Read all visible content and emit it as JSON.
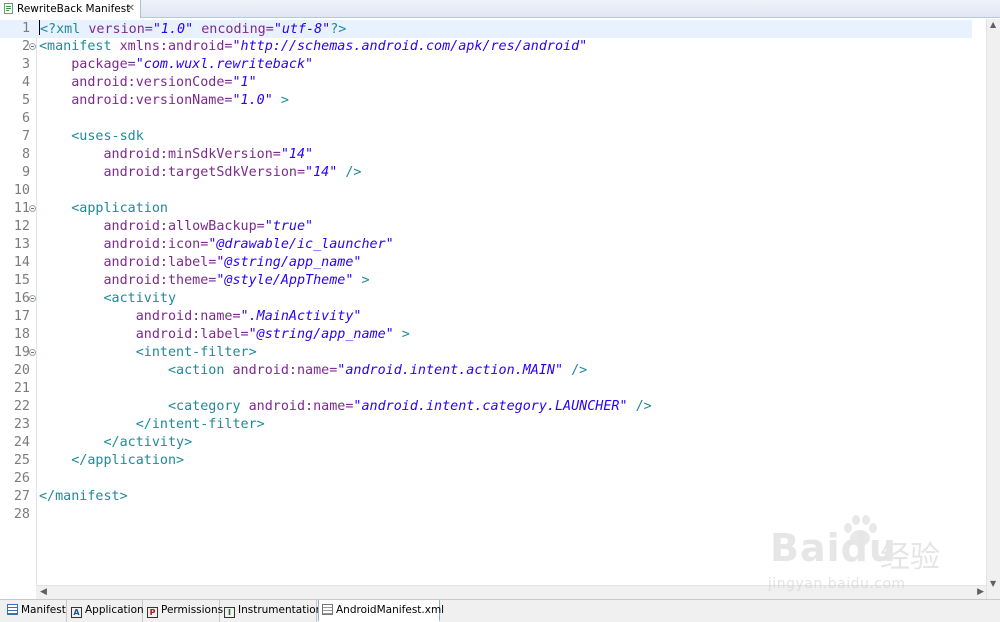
{
  "editor_tab": {
    "title": "RewriteBack Manifest",
    "close_glyph": "✕"
  },
  "lines": [
    {
      "n": "1",
      "parts": [
        {
          "t": "<?",
          "c": "tg"
        },
        {
          "t": "xml ",
          "c": "tg"
        },
        {
          "t": "version=",
          "c": "at"
        },
        {
          "t": "\"1.0\"",
          "c": "vl"
        },
        {
          "t": " encoding=",
          "c": "at"
        },
        {
          "t": "\"utf-8\"",
          "c": "vl"
        },
        {
          "t": "?>",
          "c": "tg"
        }
      ]
    },
    {
      "n": "2",
      "fold": true,
      "parts": [
        {
          "t": "<manifest ",
          "c": "tg"
        },
        {
          "t": "xmlns:android=",
          "c": "at"
        },
        {
          "t": "\"http://schemas.android.com/apk/res/android\"",
          "c": "vl"
        }
      ]
    },
    {
      "n": "3",
      "parts": [
        {
          "t": "    package=",
          "c": "at"
        },
        {
          "t": "\"com.wuxl.rewriteback\"",
          "c": "vl"
        }
      ]
    },
    {
      "n": "4",
      "parts": [
        {
          "t": "    android:versionCode=",
          "c": "at"
        },
        {
          "t": "\"1\"",
          "c": "vl"
        }
      ]
    },
    {
      "n": "5",
      "parts": [
        {
          "t": "    android:versionName=",
          "c": "at"
        },
        {
          "t": "\"1.0\"",
          "c": "vl"
        },
        {
          "t": " >",
          "c": "tg"
        }
      ]
    },
    {
      "n": "6",
      "parts": []
    },
    {
      "n": "7",
      "parts": [
        {
          "t": "    <uses-sdk",
          "c": "tg"
        }
      ]
    },
    {
      "n": "8",
      "parts": [
        {
          "t": "        android:minSdkVersion=",
          "c": "at"
        },
        {
          "t": "\"14\"",
          "c": "vl"
        }
      ]
    },
    {
      "n": "9",
      "parts": [
        {
          "t": "        android:targetSdkVersion=",
          "c": "at"
        },
        {
          "t": "\"14\"",
          "c": "vl"
        },
        {
          "t": " />",
          "c": "tg"
        }
      ]
    },
    {
      "n": "10",
      "parts": []
    },
    {
      "n": "11",
      "fold": true,
      "parts": [
        {
          "t": "    <application",
          "c": "tg"
        }
      ]
    },
    {
      "n": "12",
      "parts": [
        {
          "t": "        android:allowBackup=",
          "c": "at"
        },
        {
          "t": "\"true\"",
          "c": "vl"
        }
      ]
    },
    {
      "n": "13",
      "parts": [
        {
          "t": "        android:icon=",
          "c": "at"
        },
        {
          "t": "\"@drawable/ic_launcher\"",
          "c": "vl"
        }
      ]
    },
    {
      "n": "14",
      "parts": [
        {
          "t": "        android:label=",
          "c": "at"
        },
        {
          "t": "\"@string/app_name\"",
          "c": "vl"
        }
      ]
    },
    {
      "n": "15",
      "parts": [
        {
          "t": "        android:theme=",
          "c": "at"
        },
        {
          "t": "\"@style/AppTheme\"",
          "c": "vl"
        },
        {
          "t": " >",
          "c": "tg"
        }
      ]
    },
    {
      "n": "16",
      "fold": true,
      "parts": [
        {
          "t": "        <activity",
          "c": "tg"
        }
      ]
    },
    {
      "n": "17",
      "parts": [
        {
          "t": "            android:name=",
          "c": "at"
        },
        {
          "t": "\".MainActivity\"",
          "c": "vl"
        }
      ]
    },
    {
      "n": "18",
      "parts": [
        {
          "t": "            android:label=",
          "c": "at"
        },
        {
          "t": "\"@string/app_name\"",
          "c": "vl"
        },
        {
          "t": " >",
          "c": "tg"
        }
      ]
    },
    {
      "n": "19",
      "fold": true,
      "parts": [
        {
          "t": "            <intent-filter>",
          "c": "tg"
        }
      ]
    },
    {
      "n": "20",
      "parts": [
        {
          "t": "                <action ",
          "c": "tg"
        },
        {
          "t": "android:name=",
          "c": "at"
        },
        {
          "t": "\"android.intent.action.MAIN\"",
          "c": "vl"
        },
        {
          "t": " />",
          "c": "tg"
        }
      ]
    },
    {
      "n": "21",
      "parts": []
    },
    {
      "n": "22",
      "parts": [
        {
          "t": "                <category ",
          "c": "tg"
        },
        {
          "t": "android:name=",
          "c": "at"
        },
        {
          "t": "\"android.intent.category.LAUNCHER\"",
          "c": "vl"
        },
        {
          "t": " />",
          "c": "tg"
        }
      ]
    },
    {
      "n": "23",
      "parts": [
        {
          "t": "            </intent-filter>",
          "c": "tg"
        }
      ]
    },
    {
      "n": "24",
      "parts": [
        {
          "t": "        </activity>",
          "c": "tg"
        }
      ]
    },
    {
      "n": "25",
      "parts": [
        {
          "t": "    </application>",
          "c": "tg"
        }
      ]
    },
    {
      "n": "26",
      "parts": []
    },
    {
      "n": "27",
      "parts": [
        {
          "t": "</manifest>",
          "c": "tg"
        }
      ]
    },
    {
      "n": "28",
      "parts": []
    }
  ],
  "bottom_tabs": [
    {
      "label": "Manifest",
      "icon_glyph": "",
      "icon": "manifest-icon",
      "active": false
    },
    {
      "label": "Application",
      "icon_glyph": "A",
      "icon": "application-icon",
      "active": false
    },
    {
      "label": "Permissions",
      "icon_glyph": "P",
      "icon": "permissions-icon",
      "active": false
    },
    {
      "label": "Instrumentation",
      "icon_glyph": "I",
      "icon": "instrumentation-icon",
      "active": false
    },
    {
      "label": "AndroidManifest.xml",
      "icon_glyph": "",
      "icon": "xml-file-icon",
      "active": true
    }
  ],
  "watermark": {
    "brand": "Bai",
    "brand2": "du",
    "cn": "经验",
    "url": "jingyan.baidu.com"
  },
  "colors": {
    "tag": "#1f8a98",
    "attribute": "#7d2a8e",
    "value": "#2a00ff",
    "current_line": "#e8f2fe"
  }
}
